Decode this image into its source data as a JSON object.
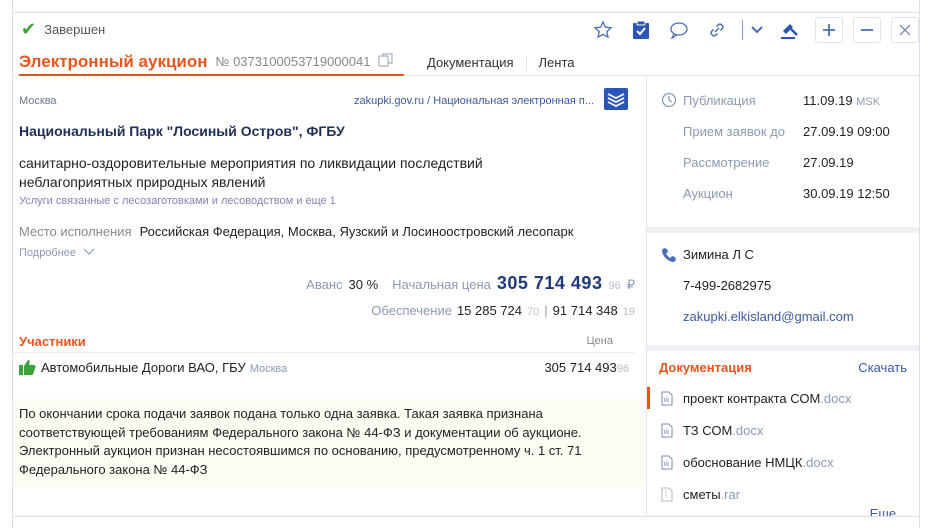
{
  "status": {
    "label": "Завершен"
  },
  "title": {
    "main": "Электронный аукцион",
    "number": "№ 0373100053719000041"
  },
  "tabs": [
    "Документация",
    "Лента"
  ],
  "region": "Москва",
  "source": "zakupki.gov.ru / Национальная электронная п...",
  "customer": "Национальный Парк \"Лосиный Остров\", ФГБУ",
  "description": "санитарно-оздоровительные мероприятия по ликвидации последствий неблагоприятных природных явлений",
  "category": "Услуги связанные с лесозаготовками и лесоводством и еще 1",
  "place": {
    "label": "Место исполнения",
    "value": "Российская Федерация, Москва, Яузский и Лосиноостровский лесопарк"
  },
  "more": "Подробнее",
  "prices": {
    "advance_label": "Аванс",
    "advance_value": "30 %",
    "start_label": "Начальная цена",
    "start_value": "305 714 493",
    "start_kop": "96",
    "currency": "₽",
    "security_label": "Обеспечение",
    "security_value": "15 285 724",
    "security_kop": "70",
    "contract_security_value": "91 714 348",
    "contract_security_kop": "19"
  },
  "participants": {
    "heading": "Участники",
    "price_col": "Цена",
    "items": [
      {
        "name": "Автомобильные Дороги ВАО, ГБУ",
        "city": "Москва",
        "price": "305 714 493",
        "kop": "96"
      }
    ]
  },
  "notice": "По окончании срока подачи заявок подана только одна заявка. Такая заявка признана соответствующей требованиям Федерального закона № 44-ФЗ и документации об аукционе. Электронный аукцион признан несостоявшимся по основанию, предусмотренному ч. 1 ст. 71 Федерального закона № 44-ФЗ",
  "dates": [
    {
      "label": "Публикация",
      "value": "11.09.19",
      "tz": "MSK"
    },
    {
      "label": "Прием заявок до",
      "value": "27.09.19 09:00",
      "tz": ""
    },
    {
      "label": "Рассмотрение",
      "value": "27.09.19",
      "tz": ""
    },
    {
      "label": "Аукцион",
      "value": "30.09.19 12:50",
      "tz": ""
    }
  ],
  "contact": {
    "name": "Зимина Л С",
    "phone": "7-499-2682975",
    "email": "zakupki.elkisland@gmail.com"
  },
  "docs": {
    "heading": "Документация",
    "download": "Скачать",
    "items": [
      {
        "name": "проект контракта СОМ",
        "ext": ".docx"
      },
      {
        "name": "ТЗ СОМ",
        "ext": ".docx"
      },
      {
        "name": "обоснование НМЦК",
        "ext": ".docx"
      },
      {
        "name": "сметы",
        "ext": ".rar"
      }
    ],
    "more": "Еще..."
  },
  "colors": {
    "accent": "#e8551e",
    "link": "#3b5aa0",
    "ok": "#3aa33a"
  }
}
